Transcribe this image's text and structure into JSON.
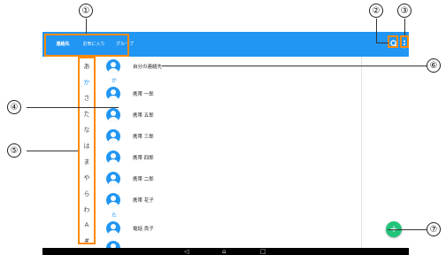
{
  "tabs": [
    {
      "label": "連絡先",
      "active": true
    },
    {
      "label": "お気に入り",
      "active": false
    },
    {
      "label": "グループ",
      "active": false
    }
  ],
  "toolbar_icons": [
    "search-icon",
    "more-vert-icon"
  ],
  "index": [
    "あ",
    "か",
    "さ",
    "た",
    "な",
    "は",
    "ま",
    "や",
    "ら",
    "わ",
    "A",
    "#"
  ],
  "my_profile": "自分の連絡先",
  "sections": [
    {
      "letter": "か",
      "contacts": [
        "携帯 一郎",
        "携帯 五郎",
        "携帯 三郎",
        "携帯 四郎",
        "携帯 二郎",
        "携帯 花子"
      ]
    },
    {
      "letter": "た",
      "contacts": [
        "電話 良子"
      ]
    }
  ],
  "fab_label": "+",
  "nav_icons": {
    "back": "◁",
    "home": "⌂",
    "recent": "□"
  },
  "callouts": [
    "①",
    "②",
    "③",
    "④",
    "⑤",
    "⑥",
    "⑦"
  ],
  "colors": {
    "accent": "#2196f3",
    "fab": "#22c37a",
    "highlight": "#ff8a00"
  }
}
